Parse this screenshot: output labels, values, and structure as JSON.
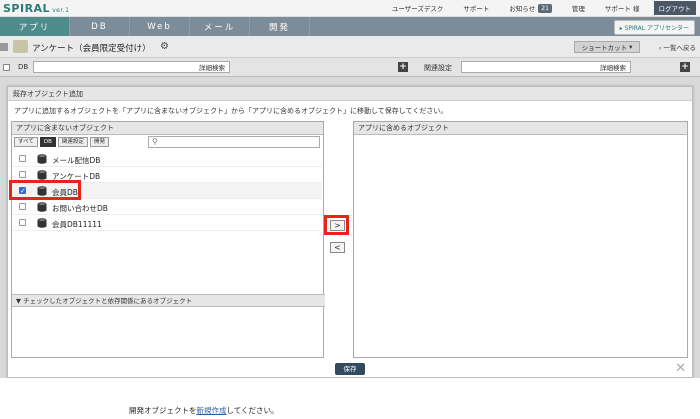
{
  "app": {
    "logo": "SPIRAL",
    "version": "ver.1"
  },
  "topnav": {
    "links": [
      "ユーザーズデスク",
      "サポート",
      "お知らせ",
      "管理",
      "サポート 様"
    ],
    "notice_count": "21",
    "logout_label": "ログアウト"
  },
  "tabs": [
    {
      "label": "アプリ",
      "active": true
    },
    {
      "label": "DB",
      "active": false
    },
    {
      "label": "Web",
      "active": false
    },
    {
      "label": "メール",
      "active": false
    },
    {
      "label": "開発",
      "active": false
    }
  ],
  "app_center_label": "SPIRAL アプリセンター",
  "header": {
    "title": "アンケート（会員限定受付け）",
    "shortcut_label": "ショートカット",
    "back_label": "一覧へ戻る"
  },
  "dbbar": {
    "db_label": "DB",
    "search_label": "詳細検索",
    "related_label": "関連設定",
    "search_label_2": "詳細検索"
  },
  "dialog": {
    "title": "既存オブジェクト追加",
    "description": "アプリに追加するオブジェクトを「アプリに含まないオブジェクト」から「アプリに含めるオブジェクト」に移動して保存してください。",
    "left_panel_title": "アプリに含まないオブジェクト",
    "right_panel_title": "アプリに含めるオブジェクト",
    "filters": [
      {
        "label": "すべて",
        "active": false
      },
      {
        "label": "DB",
        "active": true
      },
      {
        "label": "関連設定",
        "active": false
      },
      {
        "label": "開発",
        "active": false
      }
    ],
    "items": [
      {
        "name": "メール配信DB",
        "checked": false
      },
      {
        "name": "アンケートDB",
        "checked": false
      },
      {
        "name": "会員DB",
        "checked": true
      },
      {
        "name": "お問い合わせDB",
        "checked": false
      },
      {
        "name": "会員DB11111",
        "checked": false
      }
    ],
    "dependency_header": "▼ チェックしたオブジェクトと依存関係にあるオブジェクト",
    "move_right_label": ">",
    "move_left_label": "<",
    "save_label": "保存",
    "close_label": "✕"
  },
  "footer": {
    "prefix": "開発オブジェクトを",
    "link": "新規作成",
    "suffix": "してください。"
  },
  "colors": {
    "tab_active": "#4d8c8a",
    "tab_bar": "#7c8c98",
    "highlight": "#e8231b",
    "checkbox_checked": "#2d6fd2",
    "save_button": "#334a5e"
  }
}
